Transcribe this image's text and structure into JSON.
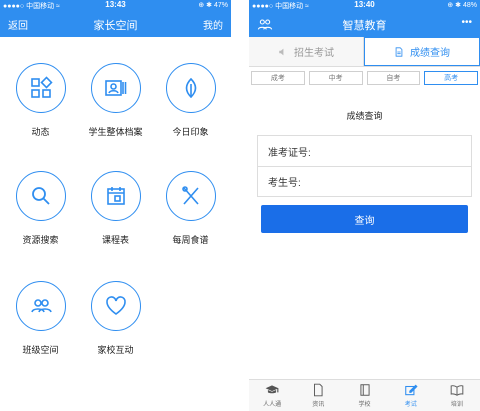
{
  "left": {
    "status": {
      "carrier": "●●●●○ 中国移动 ≈",
      "time": "13:43",
      "battery": "⊕ ✱ 47%"
    },
    "nav": {
      "back": "返回",
      "title": "家长空间",
      "right": "我的"
    },
    "items": [
      {
        "label": "动态",
        "icon": "grid-icon"
      },
      {
        "label": "学生整体档案",
        "icon": "profile-card-icon"
      },
      {
        "label": "今日印象",
        "icon": "leaf-icon"
      },
      {
        "label": "资源搜索",
        "icon": "search-icon"
      },
      {
        "label": "课程表",
        "icon": "calendar-icon"
      },
      {
        "label": "每周食谱",
        "icon": "utensils-icon"
      },
      {
        "label": "班级空间",
        "icon": "group-icon"
      },
      {
        "label": "家校互动",
        "icon": "heart-icon"
      }
    ]
  },
  "right": {
    "status": {
      "carrier": "●●●●○ 中国移动 ≈",
      "time": "13:40",
      "battery": "⊕ ✱ 48%"
    },
    "nav": {
      "title": "智慧教育",
      "more": "•••"
    },
    "segments": [
      {
        "label": "招生考试",
        "icon": "speaker-icon",
        "active": false
      },
      {
        "label": "成绩查询",
        "icon": "document-icon",
        "active": true
      }
    ],
    "subtabs": [
      "成考",
      "中考",
      "自考",
      "高考"
    ],
    "section_title": "成绩查询",
    "form": {
      "exam_id_label": "准考证号:",
      "name_label": "考生号:"
    },
    "query_button": "查询",
    "tabs": [
      {
        "label": "人人通",
        "icon": "mortarboard-icon"
      },
      {
        "label": "资讯",
        "icon": "file-icon"
      },
      {
        "label": "学校",
        "icon": "book-icon"
      },
      {
        "label": "考试",
        "icon": "edit-icon"
      },
      {
        "label": "培训",
        "icon": "open-book-icon"
      }
    ]
  },
  "colors": {
    "primary": "#2f8ef0",
    "button": "#1a6ee8"
  }
}
